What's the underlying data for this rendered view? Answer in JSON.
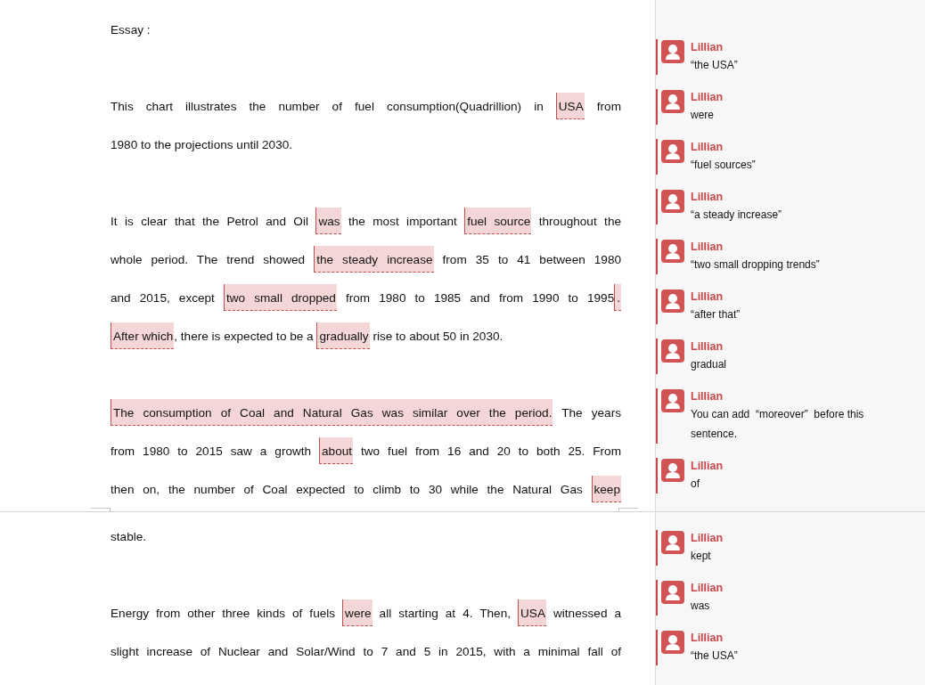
{
  "pages": [
    {
      "paragraphs": [
        {
          "lines": [
            [
              {
                "text": "Essay :",
                "highlighted": false
              }
            ]
          ]
        },
        {
          "lines": [
            [
              {
                "text": "This chart illustrates the number of fuel consumption(Quadrillion) in ",
                "highlighted": false
              },
              {
                "text": "USA",
                "highlighted": true
              },
              {
                "text": " from",
                "highlighted": false
              }
            ],
            [
              {
                "text": "1980 to the projections until 2030.",
                "highlighted": false
              }
            ]
          ]
        },
        {
          "lines": [
            [
              {
                "text": "It is clear that the Petrol and Oil ",
                "highlighted": false
              },
              {
                "text": "was",
                "highlighted": true
              },
              {
                "text": " the most important ",
                "highlighted": false
              },
              {
                "text": "fuel source",
                "highlighted": true
              },
              {
                "text": " throughout the",
                "highlighted": false
              }
            ],
            [
              {
                "text": "whole period. The trend showed ",
                "highlighted": false
              },
              {
                "text": "the steady increase",
                "highlighted": true
              },
              {
                "text": " from 35 to 41 between 1980",
                "highlighted": false
              }
            ],
            [
              {
                "text": "and 2015, except ",
                "highlighted": false
              },
              {
                "text": "two small dropped",
                "highlighted": true
              },
              {
                "text": " from 1980 to 1985 and from 1990 to 1995",
                "highlighted": false
              },
              {
                "text": ".",
                "highlighted": true
              }
            ],
            [
              {
                "text": "After which",
                "highlighted": true
              },
              {
                "text": ", there is expected to be a ",
                "highlighted": false
              },
              {
                "text": "gradually",
                "highlighted": true
              },
              {
                "text": " rise to about 50 in 2030.",
                "highlighted": false
              }
            ]
          ]
        },
        {
          "lines": [
            [
              {
                "text": "The consumption of Coal and Natural Gas was similar over the period.",
                "highlighted": true
              },
              {
                "text": " The years",
                "highlighted": false
              }
            ],
            [
              {
                "text": "from 1980 to 2015 saw a growth ",
                "highlighted": false
              },
              {
                "text": "about",
                "highlighted": true
              },
              {
                "text": " two fuel from 16 and 20 to both 25. From",
                "highlighted": false
              }
            ],
            [
              {
                "text": "then on, the number of Coal expected to climb to 30 while the Natural Gas ",
                "highlighted": false
              },
              {
                "text": "keep",
                "highlighted": true
              }
            ]
          ]
        }
      ],
      "comments": [
        {
          "author": "Lillian",
          "text": "“the USA”"
        },
        {
          "author": "Lillian",
          "text": "were"
        },
        {
          "author": "Lillian",
          "text": "“fuel sources”"
        },
        {
          "author": "Lillian",
          "text": "“a steady increase”"
        },
        {
          "author": "Lillian",
          "text": "“two small dropping trends”"
        },
        {
          "author": "Lillian",
          "text": "“after that”"
        },
        {
          "author": "Lillian",
          "text": "gradual"
        },
        {
          "author": "Lillian",
          "text": "You can add  “moreover”  before this sentence."
        },
        {
          "author": "Lillian",
          "text": "of"
        }
      ]
    },
    {
      "paragraphs": [
        {
          "lines": [
            [
              {
                "text": "stable.",
                "highlighted": false
              }
            ]
          ]
        },
        {
          "lines": [
            [
              {
                "text": "Energy from other three kinds of fuels ",
                "highlighted": false
              },
              {
                "text": "were",
                "highlighted": true
              },
              {
                "text": " all starting at 4. Then, ",
                "highlighted": false
              },
              {
                "text": "USA",
                "highlighted": true
              },
              {
                "text": " witnessed a",
                "highlighted": false
              }
            ],
            [
              {
                "text": "slight increase of Nuclear and Solar/Wind to 7 and 5 in 2015, with a minimal fall of",
                "highlighted": false
              }
            ]
          ]
        }
      ],
      "comments": [
        {
          "author": "Lillian",
          "text": "kept"
        },
        {
          "author": "Lillian",
          "text": "was"
        },
        {
          "author": "Lillian",
          "text": "“the USA”"
        }
      ]
    }
  ]
}
